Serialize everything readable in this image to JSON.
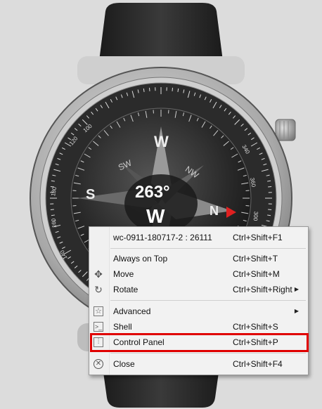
{
  "compass": {
    "heading": "263°",
    "direction_letter": "W",
    "cardinals": [
      "W",
      "S",
      "N"
    ],
    "intercardinals": [
      "SW",
      "NW"
    ],
    "ring_numbers": [
      "360",
      "340",
      "300",
      "180",
      "160",
      "140",
      "120",
      "100"
    ],
    "needle_color": "#e02020",
    "bezel_color": "#9a9a9a"
  },
  "context_menu": {
    "title_item": {
      "label": "wc-0911-180717-2 : 26111",
      "shortcut": "Ctrl+Shift+F1"
    },
    "items": [
      {
        "label": "Always on Top",
        "shortcut": "Ctrl+Shift+T",
        "icon": ""
      },
      {
        "label": "Move",
        "shortcut": "Ctrl+Shift+M",
        "icon": "move-icon"
      },
      {
        "label": "Rotate",
        "shortcut": "Ctrl+Shift+Right",
        "icon": "rotate-icon"
      },
      {
        "label": "Advanced",
        "shortcut": "",
        "icon": "star-icon"
      },
      {
        "label": "Shell",
        "shortcut": "Ctrl+Shift+S",
        "icon": "shell-icon"
      },
      {
        "label": "Control Panel",
        "shortcut": "Ctrl+Shift+P",
        "icon": "sliders-icon"
      },
      {
        "label": "Close",
        "shortcut": "Ctrl+Shift+F4",
        "icon": "close-icon"
      }
    ],
    "highlight_color": "#e00000"
  }
}
